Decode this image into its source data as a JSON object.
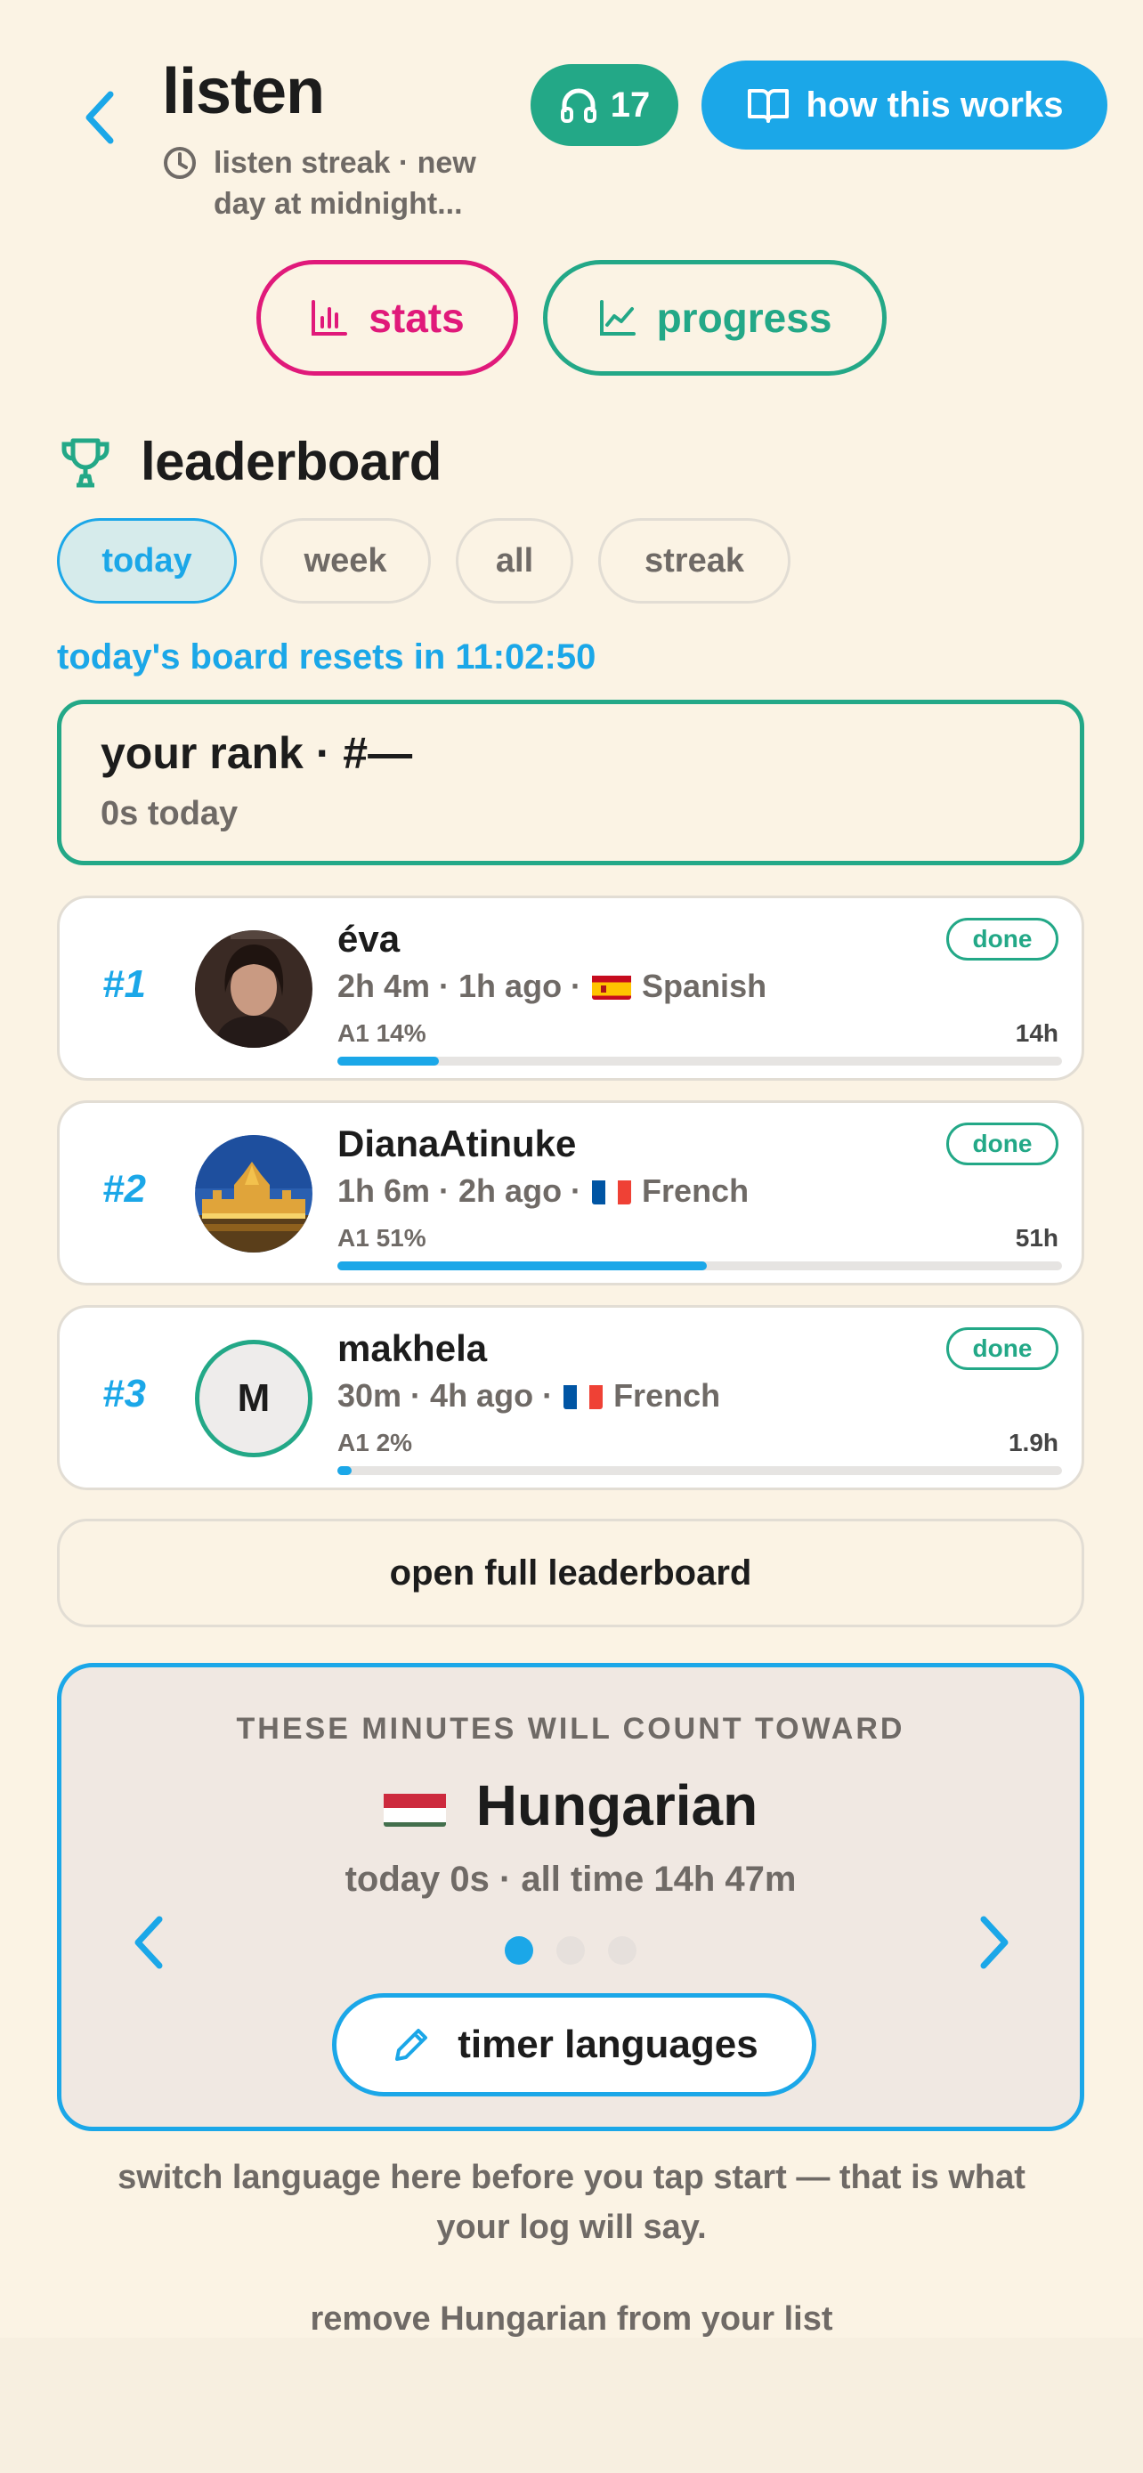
{
  "header": {
    "title": "listen",
    "subtitle": "listen streak · new day at midnight...",
    "streak_count": "17",
    "how_label": "how this works"
  },
  "actions": {
    "stats_label": "stats",
    "progress_label": "progress"
  },
  "leaderboard": {
    "title": "leaderboard",
    "tabs": [
      {
        "label": "today",
        "active": true
      },
      {
        "label": "week",
        "active": false
      },
      {
        "label": "all",
        "active": false
      },
      {
        "label": "streak",
        "active": false
      }
    ],
    "reset_text": "today's board resets in 11:02:50",
    "your_rank": {
      "title": "your rank · #—",
      "sub": "0s today"
    },
    "entries": [
      {
        "rank": "#1",
        "name": "éva",
        "meta": "2h 4m · 1h ago ·",
        "language": "Spanish",
        "level": "A1 14%",
        "progress": 0.14,
        "hours": "14h",
        "status": "done"
      },
      {
        "rank": "#2",
        "name": "DianaAtinuke",
        "meta": "1h 6m · 2h ago ·",
        "language": "French",
        "level": "A1 51%",
        "progress": 0.51,
        "hours": "51h",
        "status": "done"
      },
      {
        "rank": "#3",
        "name": "makhela",
        "initial": "M",
        "meta": "30m · 4h ago ·",
        "language": "French",
        "level": "A1 2%",
        "progress": 0.02,
        "hours": "1.9h",
        "status": "done"
      }
    ],
    "open_full": "open full leaderboard"
  },
  "count_toward": {
    "label": "THESE MINUTES WILL COUNT TOWARD",
    "language": "Hungarian",
    "stats": "today 0s · all time 14h 47m",
    "timer_button": "timer languages"
  },
  "footer": {
    "note": "switch language here before you tap start — that is what your log will say.",
    "remove": "remove Hungarian from your list"
  },
  "colors": {
    "blue": "#1ba7e8",
    "green": "#23a887",
    "pink": "#e0197a",
    "background": "#fbf3e4"
  }
}
